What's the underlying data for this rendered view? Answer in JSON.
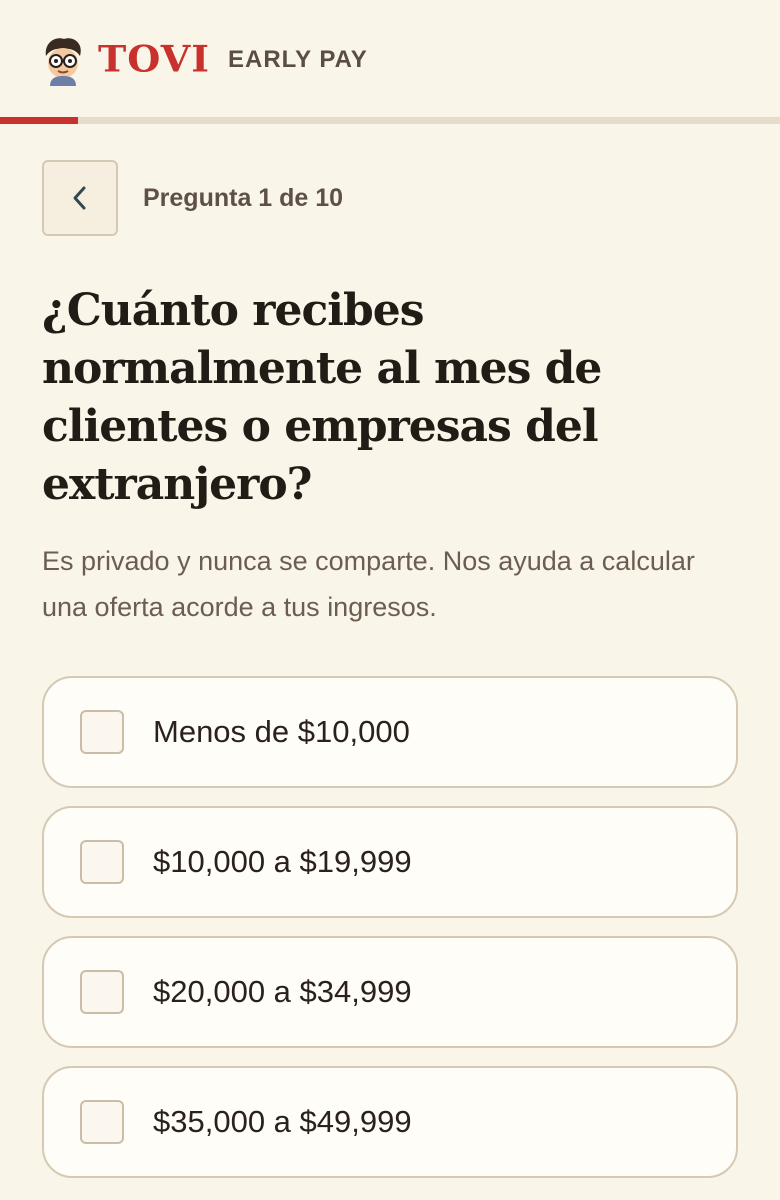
{
  "header": {
    "brand": "TOVI",
    "product": "EARLY PAY",
    "logo_icon": "mascot-icon"
  },
  "progress": {
    "value": 0.1,
    "accent": "#c8312c"
  },
  "nav": {
    "back_icon": "chevron-left-icon",
    "counter": "Pregunta 1 de 10"
  },
  "question": {
    "title": "¿Cuánto recibes normalmente al mes de clientes o empresas del extranjero?",
    "subtitle": "Es privado y nunca se comparte. Nos ayuda a calcular una oferta acorde a tus ingresos."
  },
  "options": [
    {
      "label": "Menos de $10,000",
      "checked": false
    },
    {
      "label": "$10,000 a $19,999",
      "checked": false
    },
    {
      "label": "$20,000 a $34,999",
      "checked": false
    },
    {
      "label": "$35,000 a $49,999",
      "checked": false
    }
  ]
}
